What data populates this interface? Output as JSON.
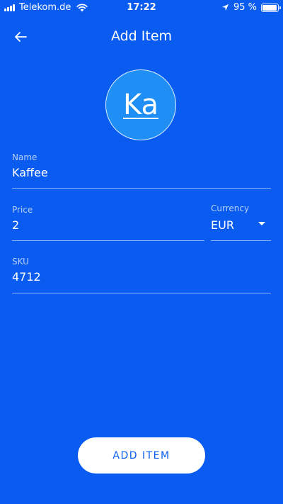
{
  "status_bar": {
    "carrier": "Telekom.de",
    "time": "17:22",
    "battery": "95 %",
    "battery_level": 0.95,
    "icons": [
      "signal-icon",
      "wifi-icon",
      "location-icon",
      "battery-icon"
    ]
  },
  "app_bar": {
    "title": "Add Item",
    "back_icon": "arrow-left-icon"
  },
  "avatar": {
    "initials": "Ka"
  },
  "form": {
    "name": {
      "label": "Name",
      "value": "Kaffee"
    },
    "price": {
      "label": "Price",
      "value": "2"
    },
    "currency": {
      "label": "Currency",
      "value": "EUR",
      "icon": "dropdown-arrow-icon"
    },
    "sku": {
      "label": "SKU",
      "value": "4712"
    }
  },
  "submit": {
    "label": "ADD ITEM"
  },
  "colors": {
    "background": "#0a5cf0",
    "avatar": "#1f8ff5",
    "button_bg": "#ffffff",
    "button_text": "#0a5cf0"
  }
}
